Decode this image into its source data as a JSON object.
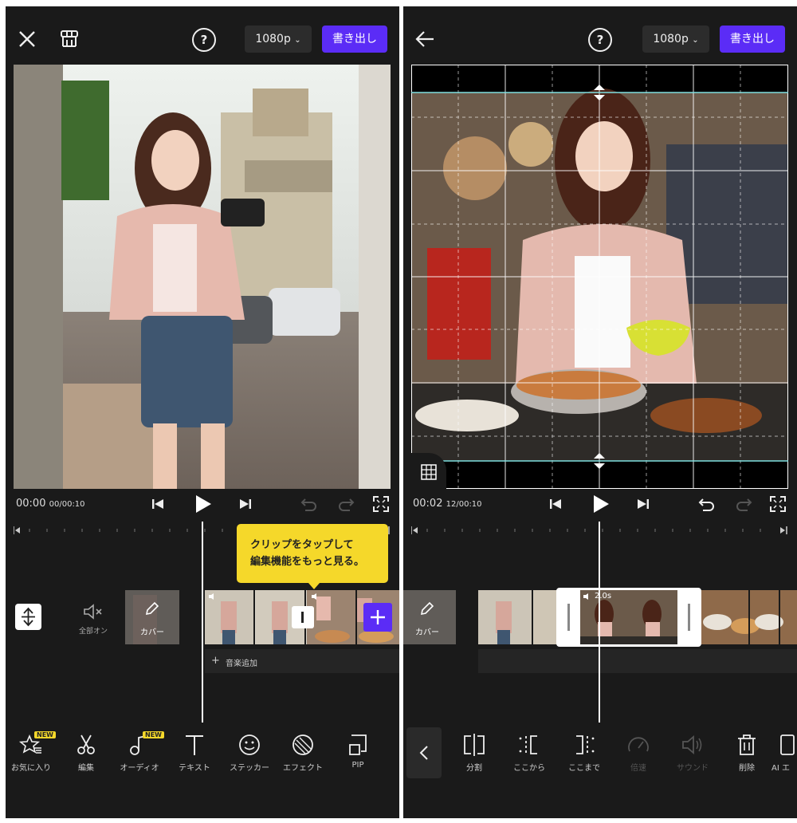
{
  "left": {
    "header": {
      "resolution": "1080p",
      "export_label": "書き出し",
      "help": "?"
    },
    "timecode": {
      "current": "00:00",
      "frames": "00",
      "total": "/00:10"
    },
    "tooltip": {
      "line1": "クリップをタップして",
      "line2": "編集機能をもっと見る。"
    },
    "track": {
      "mute_label": "全部オン",
      "cover_label": "カバー",
      "add_music_label": "音楽追加"
    },
    "toolbar": [
      {
        "label": "お気に入り",
        "icon": "favorites-icon",
        "badge": "NEW"
      },
      {
        "label": "編集",
        "icon": "scissors-icon"
      },
      {
        "label": "オーディオ",
        "icon": "audio-icon",
        "badge": "NEW"
      },
      {
        "label": "テキスト",
        "icon": "text-icon"
      },
      {
        "label": "ステッカー",
        "icon": "sticker-icon"
      },
      {
        "label": "エフェクト",
        "icon": "effect-icon"
      },
      {
        "label": "PIP",
        "icon": "pip-icon"
      }
    ]
  },
  "right": {
    "header": {
      "resolution": "1080p",
      "export_label": "書き出し",
      "help": "?"
    },
    "timecode": {
      "current": "00:02",
      "frames": "12",
      "total": "/00:10"
    },
    "track": {
      "cover_label": "カバー",
      "clip_duration": "2.0s"
    },
    "toolbar": [
      {
        "label": "分割",
        "icon": "split-icon"
      },
      {
        "label": "ここから",
        "icon": "trim-start-icon"
      },
      {
        "label": "ここまで",
        "icon": "trim-end-icon"
      },
      {
        "label": "倍速",
        "icon": "speed-icon",
        "disabled": true
      },
      {
        "label": "サウンド",
        "icon": "sound-icon",
        "disabled": true
      },
      {
        "label": "削除",
        "icon": "delete-icon"
      },
      {
        "label": "AI エ",
        "icon": "ai-icon"
      }
    ]
  },
  "colors": {
    "accent": "#5b2cf6",
    "tooltip": "#f5d82a",
    "background": "#1a1a1a",
    "guide": "#7fe0e0"
  }
}
